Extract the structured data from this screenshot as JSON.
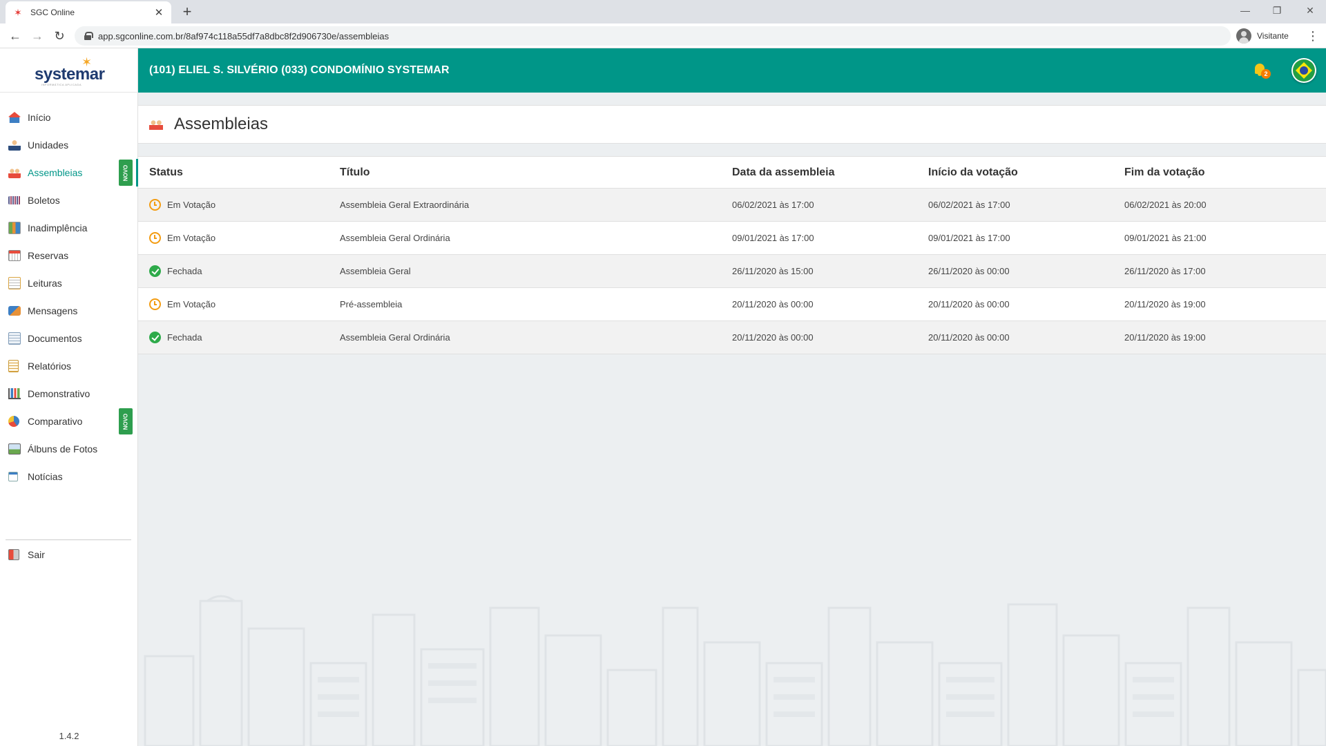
{
  "browser": {
    "tab_title": "SGC Online",
    "url": "app.sgconline.com.br/8af974c118a55df7a8dbc8f2d906730e/assembleias",
    "profile_label": "Visitante"
  },
  "brand": {
    "logo_text": "systemar",
    "logo_subtext": "INFORMÁTICA APLICADA",
    "accent_color": "#009688",
    "version": "1.4.2"
  },
  "sidebar": {
    "items": [
      {
        "label": "Início",
        "icon": "home-icon"
      },
      {
        "label": "Unidades",
        "icon": "user-icon"
      },
      {
        "label": "Assembleias",
        "icon": "people-meeting-icon",
        "active": true,
        "badge": "NOVO"
      },
      {
        "label": "Boletos",
        "icon": "barcode-icon"
      },
      {
        "label": "Inadimplência",
        "icon": "document-chart-icon"
      },
      {
        "label": "Reservas",
        "icon": "calendar-icon"
      },
      {
        "label": "Leituras",
        "icon": "meter-reading-icon"
      },
      {
        "label": "Mensagens",
        "icon": "messages-icon"
      },
      {
        "label": "Documentos",
        "icon": "documents-icon"
      },
      {
        "label": "Relatórios",
        "icon": "report-icon"
      },
      {
        "label": "Demonstrativo",
        "icon": "bar-chart-icon"
      },
      {
        "label": "Comparativo",
        "icon": "pie-chart-icon",
        "badge": "NOVO"
      },
      {
        "label": "Álbuns de Fotos",
        "icon": "photo-album-icon"
      },
      {
        "label": "Notícias",
        "icon": "news-icon"
      }
    ],
    "logout_label": "Sair"
  },
  "header": {
    "title": "(101) ELIEL S. SILVÉRIO  (033) CONDOMÍNIO SYSTEMAR",
    "notification_count": "2"
  },
  "page": {
    "title": "Assembleias"
  },
  "table": {
    "columns": [
      "Status",
      "Título",
      "Data da assembleia",
      "Início da votação",
      "Fim da votação"
    ],
    "rows": [
      {
        "status": "Em Votação",
        "status_icon": "clock-icon",
        "title": "Assembleia Geral Extraordinária",
        "date": "06/02/2021 às 17:00",
        "vote_start": "06/02/2021 às 17:00",
        "vote_end": "06/02/2021 às 20:00"
      },
      {
        "status": "Em Votação",
        "status_icon": "clock-icon",
        "title": "Assembleia Geral Ordinária",
        "date": "09/01/2021 às 17:00",
        "vote_start": "09/01/2021 às 17:00",
        "vote_end": "09/01/2021 às 21:00"
      },
      {
        "status": "Fechada",
        "status_icon": "check-circle-icon",
        "title": "Assembleia Geral",
        "date": "26/11/2020 às 15:00",
        "vote_start": "26/11/2020 às 00:00",
        "vote_end": "26/11/2020 às 17:00"
      },
      {
        "status": "Em Votação",
        "status_icon": "clock-icon",
        "title": "Pré-assembleia",
        "date": "20/11/2020 às 00:00",
        "vote_start": "20/11/2020 às 00:00",
        "vote_end": "20/11/2020 às 19:00"
      },
      {
        "status": "Fechada",
        "status_icon": "check-circle-icon",
        "title": "Assembleia Geral Ordinária",
        "date": "20/11/2020 às 00:00",
        "vote_start": "20/11/2020 às 00:00",
        "vote_end": "20/11/2020 às 19:00"
      }
    ]
  },
  "colors": {
    "status_in_progress": "#f39c12",
    "status_closed": "#2eaa4a",
    "badge_novo": "#2e9e4e"
  }
}
